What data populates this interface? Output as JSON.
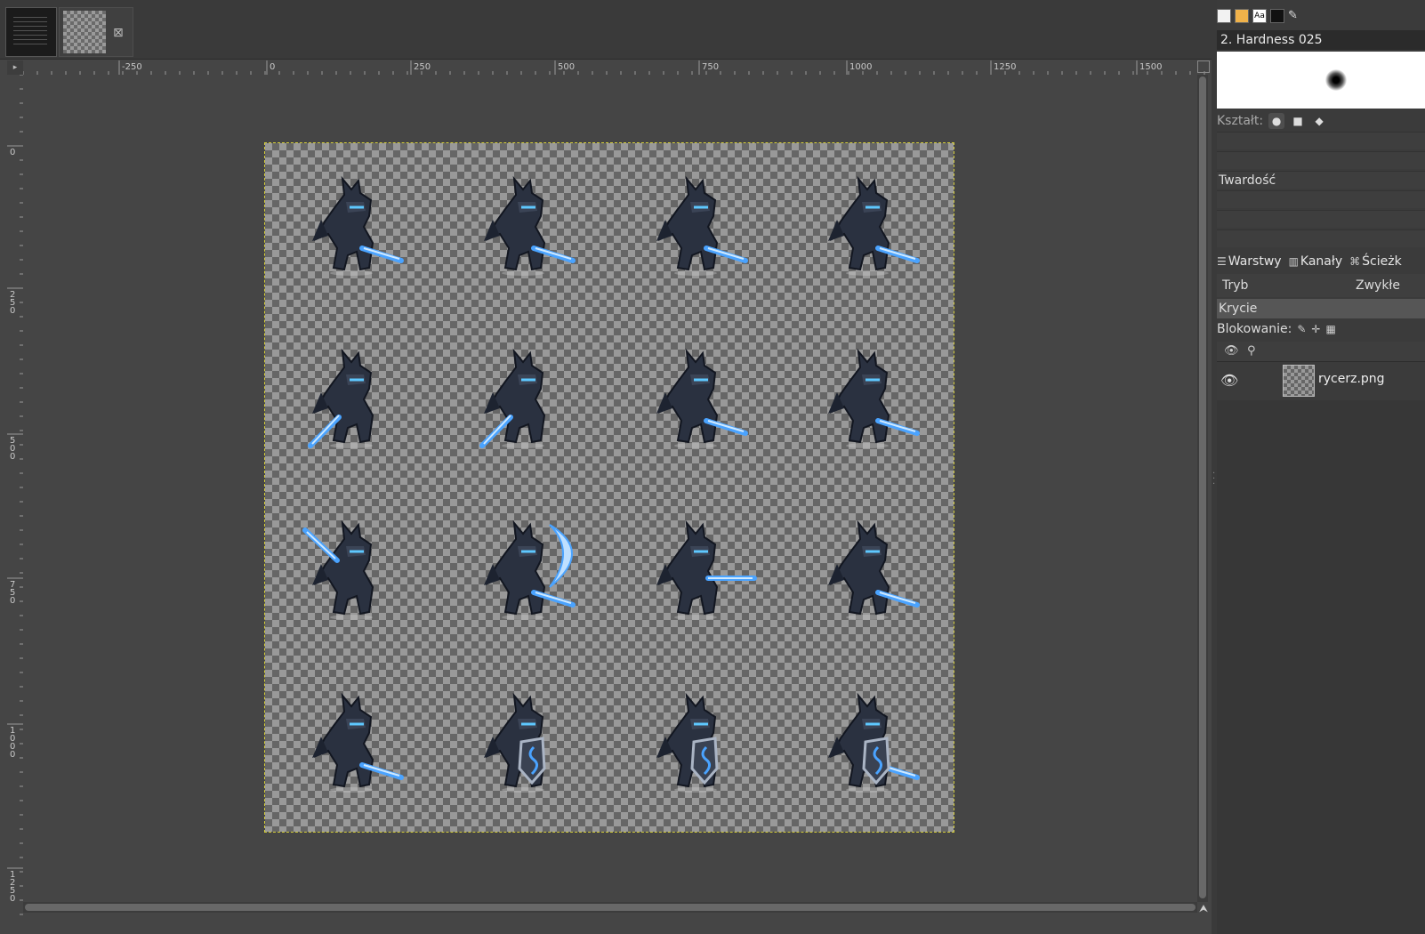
{
  "tabs": [
    {
      "name": "image-tab-1"
    },
    {
      "name": "image-tab-2",
      "close_icon": "close-icon"
    }
  ],
  "rulers": {
    "horizontal_labels": [
      "-250",
      "0",
      "250",
      "500",
      "750",
      "1000",
      "1250",
      "1500"
    ],
    "vertical_labels": [
      "0",
      "250",
      "500",
      "750",
      "1000",
      "1250"
    ]
  },
  "canvas": {
    "image_layer": "rycerz.png",
    "sprite_grid": {
      "columns": 4,
      "rows": 4
    },
    "sprites": [
      "knight-sword-idle",
      "knight-sword-idle",
      "knight-sword-idle",
      "knight-sword-idle",
      "knight-sword-low",
      "knight-jump",
      "knight-leap",
      "knight-slash",
      "knight-raise-sword",
      "knight-arc-slash",
      "knight-thrust",
      "knight-sword-idle",
      "knight-sword-idle",
      "knight-shield",
      "knight-shield",
      "knight-shield-sword"
    ],
    "selection_color": "#d6cf3a"
  },
  "dock": {
    "brush_name": "2. Hardness 025",
    "shape_label": "Kształt:",
    "shape_options": [
      "circle",
      "square",
      "diamond"
    ],
    "options_rows": [
      "",
      "",
      "Twardość",
      "",
      "",
      ""
    ],
    "layers_tabs": [
      {
        "label": "Warstwy",
        "icon": "layers-icon"
      },
      {
        "label": "Kanały",
        "icon": "channels-icon"
      },
      {
        "label": "Ścieżk",
        "icon": "paths-icon"
      }
    ],
    "mode_label": "Tryb",
    "mode_value": "Zwykłe",
    "opacity_label": "Krycie",
    "lock_label": "Blokowanie:",
    "layers": [
      {
        "name": "rycerz.png",
        "visible": true
      }
    ]
  }
}
